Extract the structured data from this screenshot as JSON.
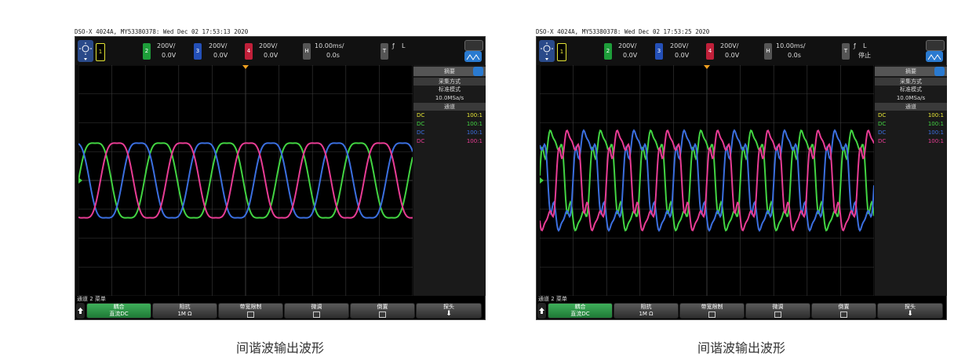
{
  "panels": [
    {
      "header": "DSO-X 4024A, MY53380378: Wed Dec 02 17:53:13 2020",
      "trigger_state": "L",
      "trigger_state2": "",
      "caption": "间谐波输出波形"
    },
    {
      "header": "DSO-X 4024A, MY53380378: Wed Dec 02 17:53:25 2020",
      "trigger_state": "L",
      "trigger_state2": "停止",
      "caption": "间谐波输出波形"
    }
  ],
  "topbar": {
    "ch1": "1",
    "ch2": "2",
    "ch2_scale": "200V/",
    "ch2_offset": "0.0V",
    "ch3": "3",
    "ch3_scale": "200V/",
    "ch3_offset": "0.0V",
    "ch4": "4",
    "ch4_scale": "200V/",
    "ch4_offset": "0.0V",
    "h_label": "H",
    "h_scale": "10.00ms/",
    "h_delay": "0.0s",
    "t_label": "T",
    "trig_symbol": "ƒ"
  },
  "right_panel": {
    "title": "摘要",
    "acq_head": "采集方式",
    "acq_mode": "标准模式",
    "acq_rate": "10.0MSa/s",
    "chan_head": "通道",
    "channels": [
      {
        "coupling": "DC",
        "probe": "100:1",
        "color": "#e6e635"
      },
      {
        "coupling": "DC",
        "probe": "100:1",
        "color": "#42d442"
      },
      {
        "coupling": "DC",
        "probe": "100:1",
        "color": "#3b6fe0"
      },
      {
        "coupling": "DC",
        "probe": "100:1",
        "color": "#e83c94"
      }
    ]
  },
  "status_line": "通道 2 菜单",
  "softkeys": {
    "k1_l1": "耦合",
    "k1_l2": "直流DC",
    "k2_l1": "阻抗",
    "k2_l2": "1M Ω",
    "k3": "带宽限制",
    "k4": "微调",
    "k5": "倒置",
    "k6": "探头"
  },
  "colors": {
    "ch1": "#e6e635",
    "ch2": "#42d442",
    "ch3": "#3b6fe0",
    "ch4": "#e83c94",
    "trigger_marker": "#f0a020"
  }
}
